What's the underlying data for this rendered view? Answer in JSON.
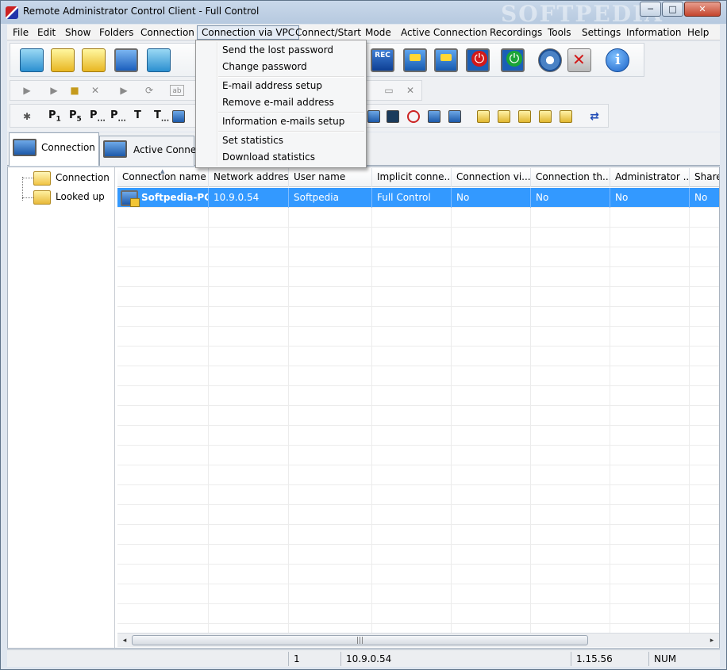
{
  "window": {
    "title": "Remote Administrator Control Client - Full Control",
    "watermark": "SOFTPEDIA",
    "controls": {
      "minimize": "─",
      "maximize": "□",
      "close": "✕"
    }
  },
  "menubar": {
    "items": [
      "File",
      "Edit",
      "Show",
      "Folders",
      "Connection",
      "Connection via VPC",
      "Connect/Start",
      "Mode",
      "Active Connection",
      "Recordings",
      "Tools",
      "Settings",
      "Information",
      "Help"
    ],
    "open_item": "Connection via VPC"
  },
  "dropdown": {
    "groups": [
      [
        "Send the lost password",
        "Change password"
      ],
      [
        "E-mail address setup",
        "Remove e-mail address"
      ],
      [
        "Information e-mails setup"
      ],
      [
        "Set statistics",
        "Download statistics"
      ]
    ]
  },
  "toolbar": {
    "rec_label": "REC",
    "row3_labels": {
      "p1": "P",
      "p1_sub": "1",
      "p5": "P",
      "p5_sub": "5",
      "pm": "P",
      "pm_sub": "...",
      "pn": "P",
      "pn_sub": "...",
      "t": "T",
      "tm": "T",
      "tm_sub": "..."
    }
  },
  "tabs": [
    {
      "label": "Connection",
      "active": true
    },
    {
      "label": "Active Connect",
      "active": false
    }
  ],
  "tree": {
    "items": [
      {
        "label": "Connection",
        "open": true
      },
      {
        "label": "Looked up",
        "open": false
      }
    ]
  },
  "grid": {
    "columns": [
      "Connection name",
      "Network address",
      "User name",
      "Implicit conne...",
      "Connection vi...",
      "Connection th...",
      "Administrator ...",
      "Share"
    ],
    "rows": [
      {
        "cells": [
          "Softpedia-PC",
          "10.9.0.54",
          "Softpedia",
          "Full Control",
          "No",
          "No",
          "No",
          "No"
        ],
        "selected": true
      }
    ],
    "sort_indicator": "▲",
    "scroll": {
      "left": "◂",
      "right": "▸",
      "grip": "|||"
    }
  },
  "statusbar": {
    "count": "1",
    "address": "10.9.0.54",
    "version": "1.15.56",
    "num": "NUM"
  },
  "colors": {
    "selection": "#3399ff",
    "menu_bg": "#f5f6f7",
    "titlebar": "#b6c9df"
  }
}
